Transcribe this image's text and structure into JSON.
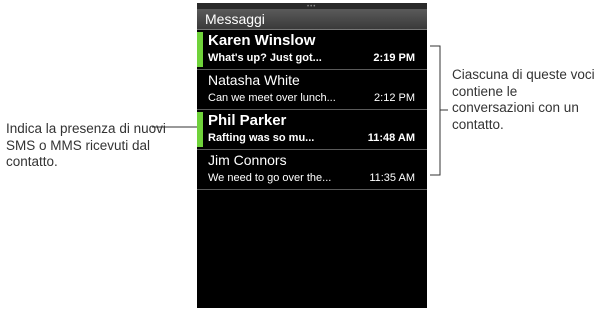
{
  "screen": {
    "title": "Messaggi"
  },
  "conversations": [
    {
      "name": "Karen Winslow",
      "preview": "What's up? Just got...",
      "time": "2:19 PM",
      "unread": true
    },
    {
      "name": "Natasha White",
      "preview": "Can we meet over lunch...",
      "time": "2:12 PM",
      "unread": false
    },
    {
      "name": "Phil Parker",
      "preview": "Rafting was so mu...",
      "time": "11:48 AM",
      "unread": true
    },
    {
      "name": "Jim Connors",
      "preview": "We need to go over the...",
      "time": "11:35 AM",
      "unread": false
    }
  ],
  "callouts": {
    "left": "Indica la presenza di nuovi SMS o MMS ricevuti dal contatto.",
    "right": "Ciascuna di queste voci contiene le conversazioni con un contatto."
  },
  "colors": {
    "unread_indicator": "#6fd23a",
    "title_bar": "#4a4a4a",
    "screen_bg": "#000000"
  }
}
